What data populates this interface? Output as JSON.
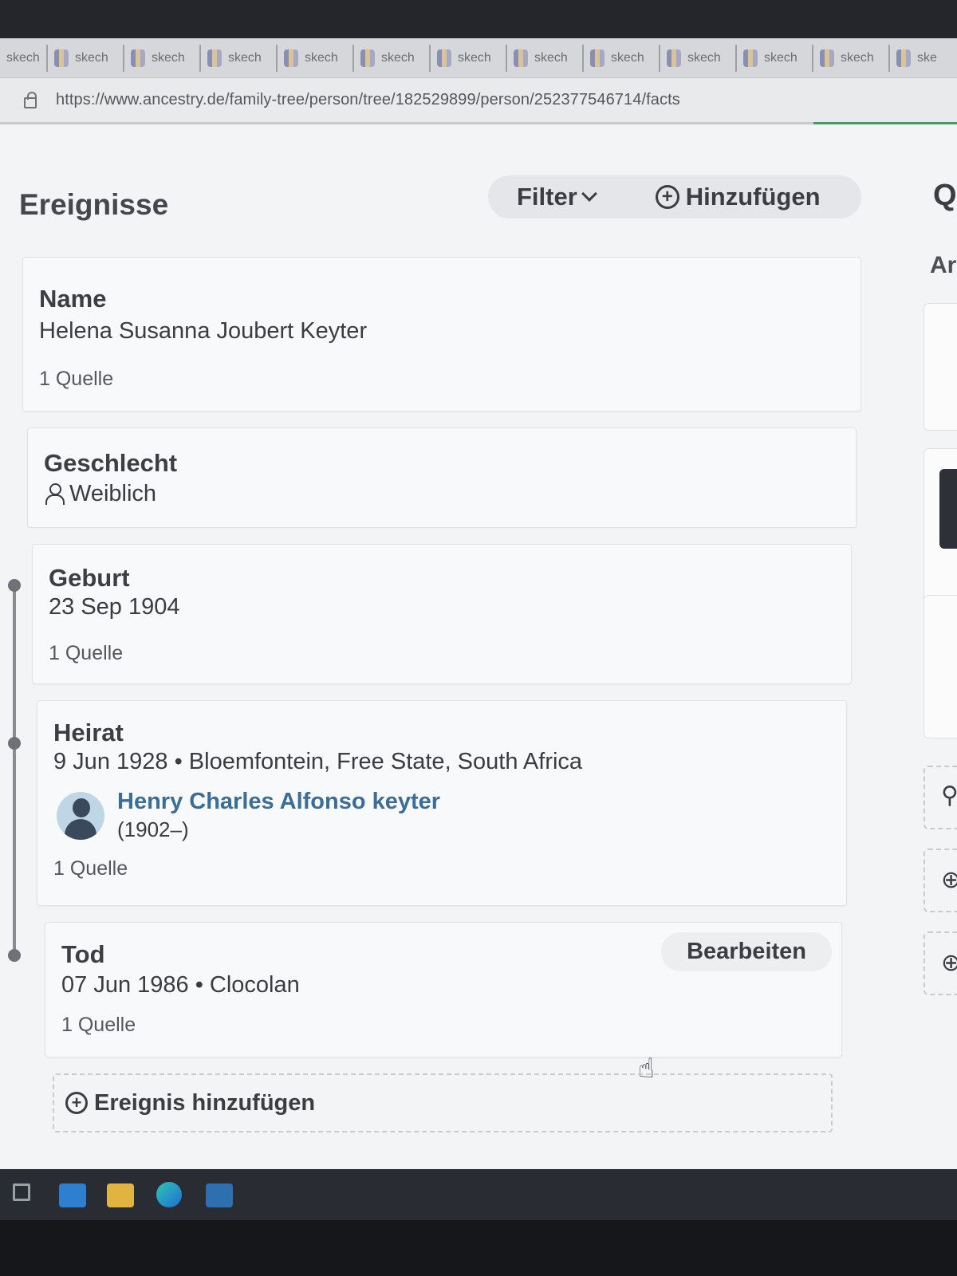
{
  "browser": {
    "tabs": [
      {
        "label": "skech"
      },
      {
        "label": "skech"
      },
      {
        "label": "skech"
      },
      {
        "label": "skech"
      },
      {
        "label": "skech"
      },
      {
        "label": "skech"
      },
      {
        "label": "skech"
      },
      {
        "label": "skech"
      },
      {
        "label": "skech"
      },
      {
        "label": "skech"
      },
      {
        "label": "skech"
      },
      {
        "label": "skech"
      },
      {
        "label": "ske"
      }
    ],
    "url": "https://www.ancestry.de/family-tree/person/tree/182529899/person/252377546714/facts"
  },
  "events": {
    "title": "Ereignisse",
    "filter_label": "Filter",
    "add_label": "Hinzufügen",
    "right_q": "Q",
    "right_ar": "Ar",
    "items": [
      {
        "label": "Name",
        "value": "Helena Susanna Joubert Keyter",
        "source": "1 Quelle"
      },
      {
        "label": "Geschlecht",
        "value": "Weiblich"
      },
      {
        "label": "Geburt",
        "value": "23 Sep 1904",
        "source": "1 Quelle"
      },
      {
        "label": "Heirat",
        "value": "9 Jun 1928 • Bloemfontein, Free State, South Africa",
        "spouse_name": "Henry Charles Alfonso keyter",
        "spouse_years": "(1902–)",
        "source": "1 Quelle"
      },
      {
        "label": "Tod",
        "value": "07 Jun 1986 • Clocolan",
        "source": "1 Quelle",
        "edit_label": "Bearbeiten"
      }
    ],
    "add_event_label": "Ereignis hinzufügen"
  },
  "colors": {
    "accent_link": "#3b6d97",
    "progress": "#3f9f5a"
  }
}
